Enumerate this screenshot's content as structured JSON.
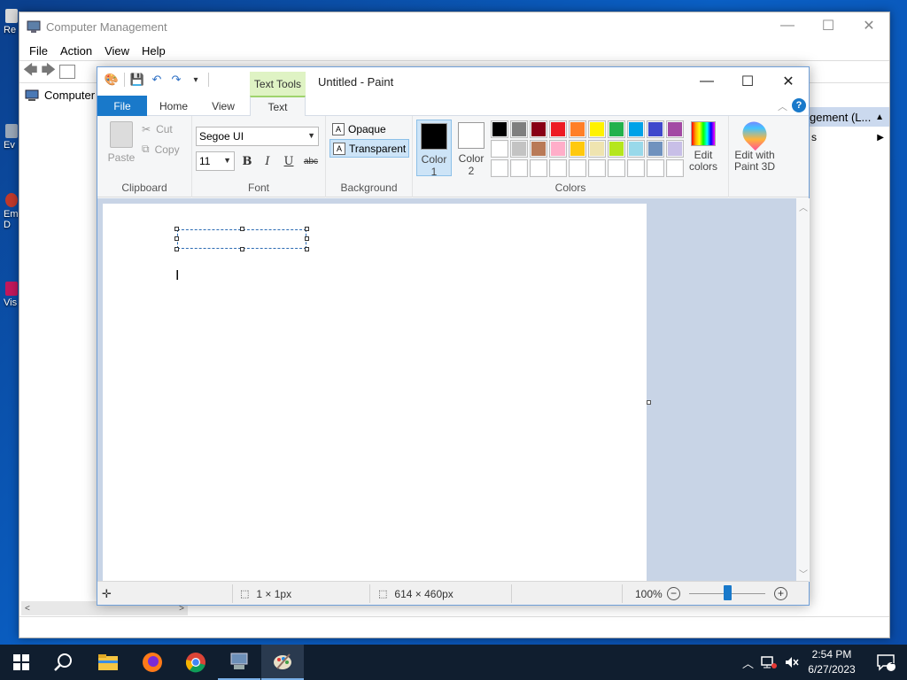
{
  "desktop": {
    "icons": [
      {
        "label": "Re",
        "color": "#d8d8d8"
      },
      {
        "label": "Ev",
        "color": "#9aa7b7"
      },
      {
        "label": "Em",
        "label2": "D",
        "color": "#c0392b"
      },
      {
        "label": "Vis",
        "color": "#c2185b"
      }
    ]
  },
  "computer_management": {
    "title": "Computer Management",
    "menu": [
      "File",
      "Action",
      "View",
      "Help"
    ],
    "tree_root": "Computer M",
    "right_pane_header": "gement (L...",
    "right_pane_sub": "s"
  },
  "paint": {
    "title": "Untitled - Paint",
    "context_tab": "Text Tools",
    "tabs": {
      "file": "File",
      "home": "Home",
      "view": "View",
      "text": "Text"
    },
    "clipboard": {
      "paste": "Paste",
      "cut": "Cut",
      "copy": "Copy",
      "group_label": "Clipboard"
    },
    "font": {
      "family": "Segoe UI",
      "size": "11",
      "bold": "B",
      "italic": "I",
      "underline": "U",
      "strike": "abc",
      "group_label": "Font"
    },
    "background": {
      "opaque": "Opaque",
      "transparent": "Transparent",
      "selected": "Transparent",
      "group_label": "Background"
    },
    "colors": {
      "color1_label": "Color",
      "color1_num": "1",
      "color1_value": "#000000",
      "color2_label": "Color",
      "color2_num": "2",
      "color2_value": "#ffffff",
      "palette": [
        "#000000",
        "#7f7f7f",
        "#880015",
        "#ed1c24",
        "#ff7f27",
        "#fff200",
        "#22b14c",
        "#00a2e8",
        "#3f48cc",
        "#a349a4",
        "#ffffff",
        "#c3c3c3",
        "#b97a57",
        "#ffaec9",
        "#ffc90e",
        "#efe4b0",
        "#b5e61d",
        "#99d9ea",
        "#7092be",
        "#c8bfe7",
        "",
        "",
        "",
        "",
        "",
        "",
        "",
        "",
        "",
        ""
      ],
      "edit_colors": "Edit colors",
      "group_label": "Colors"
    },
    "edit3d": "Edit with Paint 3D",
    "status": {
      "selection_size": "1 × 1px",
      "image_size": "614 × 460px",
      "zoom": "100%",
      "zoom_level": 1.0
    }
  },
  "taskbar": {
    "apps": [
      "start",
      "search",
      "file-explorer",
      "firefox",
      "chrome",
      "computer-management",
      "paint"
    ],
    "active_app": "paint",
    "time": "2:54 PM",
    "date": "6/27/2023",
    "notification_count": "1"
  }
}
